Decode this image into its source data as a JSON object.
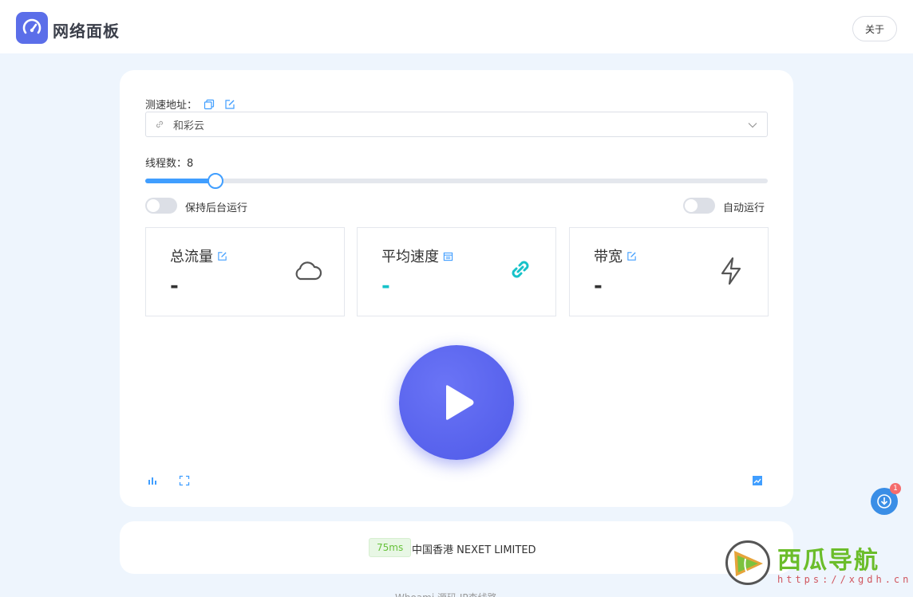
{
  "header": {
    "title": "网络面板",
    "about_label": "关于"
  },
  "speedtest": {
    "url_label": "测速地址：",
    "selected_source": "和彩云",
    "threads_label": "线程数：",
    "threads_value": "8",
    "threads_fraction": 0.113,
    "background_toggle_label": "保持后台运行",
    "background_toggle_on": false,
    "auto_run_label": "自动运行",
    "auto_run_on": false
  },
  "stats": [
    {
      "title": "总流量",
      "value": "-",
      "icon": "cloud-icon"
    },
    {
      "title": "平均速度",
      "value": "-",
      "icon": "link-icon"
    },
    {
      "title": "带宽",
      "value": "-",
      "icon": "lightning-icon"
    }
  ],
  "info": {
    "ping": "75ms",
    "isp": "中国香港 NEXET LIMITED"
  },
  "footer": {
    "text": "Whoami   源码   IP查线路"
  },
  "float_badge_count": "1",
  "watermark": {
    "title": "西瓜导航",
    "url": "https://xgdh.cn"
  },
  "colors": {
    "accent": "#409eff",
    "brand": "#5b6ee9",
    "play": "#5560ee",
    "cyan": "#16c2c9",
    "background": "#eef5fd"
  }
}
